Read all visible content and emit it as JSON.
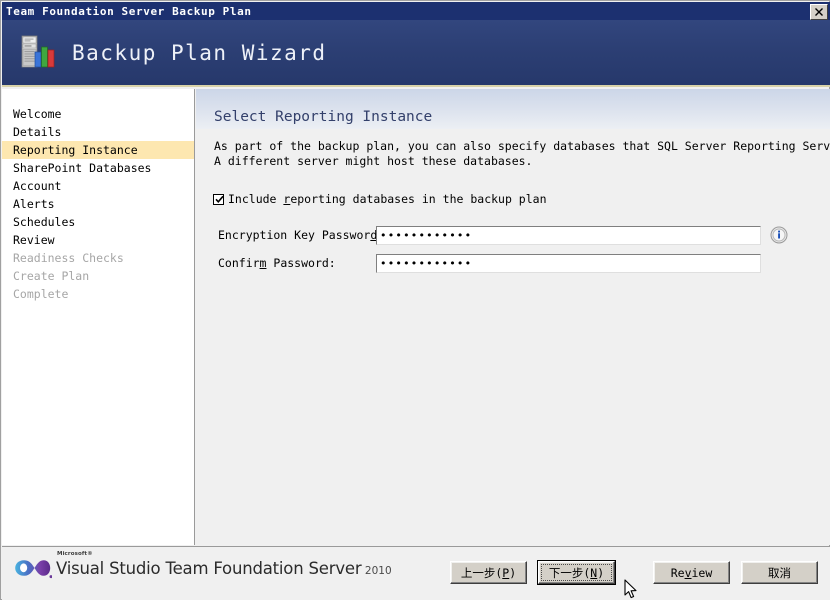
{
  "window": {
    "title": "Team Foundation Server Backup Plan",
    "close_label": "✕"
  },
  "banner": {
    "title": "Backup Plan Wizard",
    "icon": "server-chart-icon"
  },
  "sidebar": {
    "items": [
      {
        "label": "Welcome",
        "state": "done"
      },
      {
        "label": "Details",
        "state": "done"
      },
      {
        "label": "Reporting Instance",
        "state": "current"
      },
      {
        "label": "SharePoint Databases",
        "state": "done"
      },
      {
        "label": "Account",
        "state": "done"
      },
      {
        "label": "Alerts",
        "state": "done"
      },
      {
        "label": "Schedules",
        "state": "done"
      },
      {
        "label": "Review",
        "state": "done"
      },
      {
        "label": "Readiness Checks",
        "state": "disabled"
      },
      {
        "label": "Create Plan",
        "state": "disabled"
      },
      {
        "label": "Complete",
        "state": "disabled"
      }
    ],
    "highlight_color": "#fde7b0",
    "disabled_color": "#a6a6a6"
  },
  "content": {
    "heading": "Select Reporting Instance",
    "description": "As part of the backup plan, you can also specify databases that SQL Server Reporting Services use.\nA different server might host these databases.",
    "checkbox": {
      "checked": true,
      "text_before": "Include ",
      "accel": "r",
      "text_after": "eporting databases in the backup plan",
      "full_label": "Include reporting databases in the backup plan"
    },
    "fields": [
      {
        "label_before": "Encryption Key Passwor",
        "label_accel": "d",
        "label_after": ":",
        "full_label": "Encryption Key Password:",
        "value": "••••••••••••",
        "value_char_count": 12,
        "name": "encryption-key-password"
      },
      {
        "label_before": "Confir",
        "label_accel": "m",
        "label_after": " Password:",
        "full_label": "Confirm Password:",
        "value": "••••••••••••",
        "value_char_count": 12,
        "name": "confirm-password"
      }
    ],
    "info_icon": "info-icon"
  },
  "footer": {
    "logo": {
      "microsoft": "Microsoft®",
      "product": "Visual Studio Team Foundation Server",
      "year": "2010"
    },
    "buttons": [
      {
        "name": "back-button",
        "text_before": "上一步(",
        "accel": "P",
        "text_after": ")",
        "full": "上一步(P)",
        "default": false
      },
      {
        "name": "next-button",
        "text_before": "下一步(",
        "accel": "N",
        "text_after": ")",
        "full": "下一步(N)",
        "default": true
      },
      {
        "name": "review-button",
        "text_before": "Re",
        "accel": "v",
        "text_after": "iew",
        "full": "Review",
        "default": false
      },
      {
        "name": "cancel-button",
        "text_before": "取消",
        "accel": "",
        "text_after": "",
        "full": "取消",
        "default": false
      }
    ]
  },
  "colors": {
    "titlebar": "#1c3070",
    "banner_top": "#32467e",
    "banner_bottom": "#26386b",
    "banner_underline": "#d8d2a8",
    "heading_text": "#33406b",
    "panel_bg": "#f0f0f0",
    "sidebar_bg": "#ffffff",
    "button_face": "#d4d0c8"
  }
}
